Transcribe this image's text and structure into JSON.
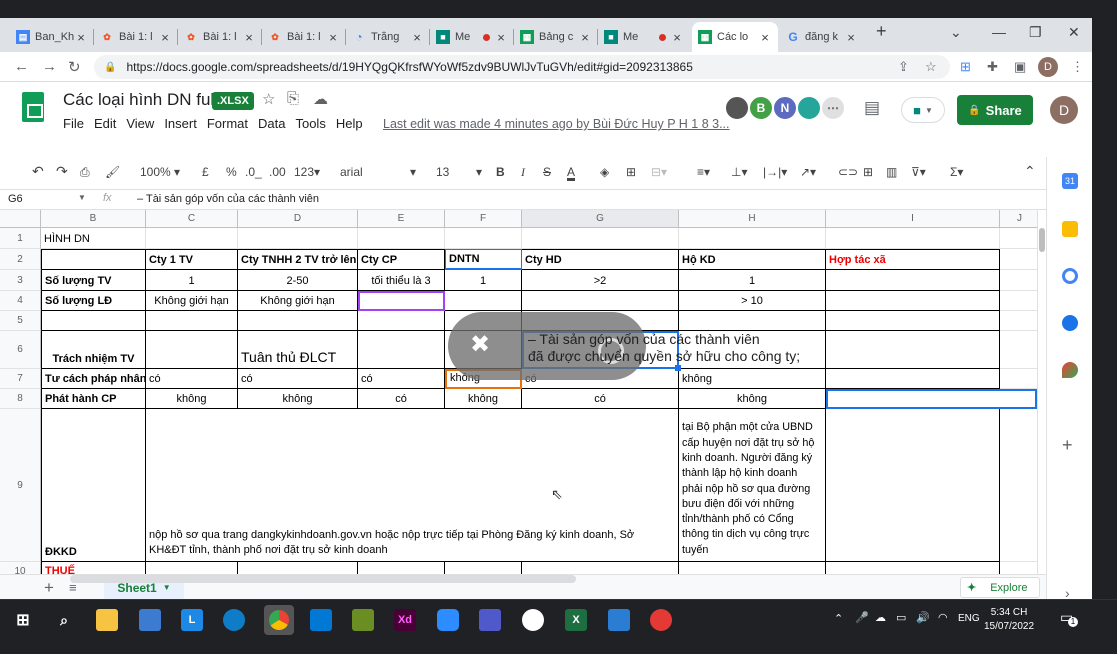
{
  "browser": {
    "tabs": [
      {
        "title": "Ban_Kh",
        "icon": "doc-icon"
      },
      {
        "title": "Bài 1: l",
        "icon": "web-icon"
      },
      {
        "title": "Bài 1: l",
        "icon": "web-icon"
      },
      {
        "title": "Bài 1: l",
        "icon": "web-icon"
      },
      {
        "title": "Trắng",
        "icon": "globe-icon"
      },
      {
        "title": "Me",
        "icon": "meet-icon"
      },
      {
        "title": "Bảng c",
        "icon": "sheets-icon"
      },
      {
        "title": "Me",
        "icon": "meet-icon"
      },
      {
        "title": "Các lo",
        "icon": "sheets-icon"
      },
      {
        "title": "đăng k",
        "icon": "google-icon"
      }
    ],
    "url": "https://docs.google.com/spreadsheets/d/19HYQgQKfrsfWYoWf5zdv9BUWlJvTuGVh/edit#gid=2092313865",
    "profile": "D"
  },
  "doc": {
    "title": "Các loại hình DN full",
    "badge": ".XLSX",
    "menus": [
      "File",
      "Edit",
      "View",
      "Insert",
      "Format",
      "Data",
      "Tools",
      "Help"
    ],
    "last_edit": "Last edit was made 4 minutes ago by Bùi Đức Huy P H 1 8 3...",
    "share": "Share",
    "collaborators": [
      "B",
      "N"
    ],
    "user": "D"
  },
  "toolbar": {
    "zoom": "100%",
    "currency": "£",
    "percent": "%",
    "dec_less": ".0_",
    "dec_more": ".00",
    "format": "123",
    "font": "arial",
    "size": "13"
  },
  "formula": {
    "cell": "G6",
    "fx": "fx",
    "value": "– Tài sản góp vốn của các thành viên"
  },
  "columns": [
    "B",
    "C",
    "D",
    "E",
    "F",
    "G",
    "H",
    "I",
    "J"
  ],
  "rows": [
    "1",
    "2",
    "3",
    "4",
    "5",
    "6",
    "7",
    "8",
    "9",
    "10"
  ],
  "cells": {
    "r1": {
      "b": "HÌNH DN"
    },
    "r2": {
      "c": "Cty 1 TV",
      "d": "Cty TNHH 2 TV trở lên",
      "e": "Cty CP",
      "f": "DNTN",
      "g": "Cty HD",
      "h": "Hộ KD",
      "i": "Hợp tác xã"
    },
    "r3": {
      "b": "Số lượng TV",
      "c": "1",
      "d": "2-50",
      "e": "tối thiểu là 3",
      "f": "1",
      "g": ">2",
      "h": "1"
    },
    "r4": {
      "b": "Số lượng LĐ",
      "c": "Không giới hạn",
      "d": "Không giới hạn",
      "h": "> 10"
    },
    "r6": {
      "b": "Trách nhiệm TV",
      "d": "Tuân thủ ĐLCT",
      "g1": "– Tài sản góp vốn của các thành viên",
      "g2": " đã được chuyển quyền sở hữu cho công ty;"
    },
    "r7": {
      "b": "Tư cách pháp nhân",
      "c": "có",
      "d": "có",
      "e": "có",
      "f": "không",
      "g": "có",
      "h": "không"
    },
    "r8": {
      "b": "Phát hành CP",
      "c": "không",
      "d": "không",
      "e": "có",
      "f": "không",
      "g": "có",
      "h": "không"
    },
    "r9": {
      "b": "ĐKKD",
      "c1": "nộp hồ sơ qua trang dangkykinhdoanh.gov.vn hoặc nộp trực tiếp tại Phòng Đăng ký kinh doanh, Sở",
      "c2": "KH&ĐT tỉnh, thành phố nơi đặt trụ sở kinh doanh",
      "h": [
        "tại Bộ phận một cửa UBND",
        "cấp huyện nơi đặt trụ sở hộ",
        "kinh doanh. Người đăng ký",
        "thành lập hộ kinh doanh",
        "phải nộp hồ sơ qua đường",
        "bưu điện đối với những",
        "tỉnh/thành phố có Cổng",
        "thông tin dịch vụ công trực",
        "tuyến"
      ]
    },
    "r10": {
      "b": "THUẾ"
    }
  },
  "sheet_tab": "Sheet1",
  "explore": "Explore",
  "taskbar": {
    "lang": "ENG",
    "time": "5:34 CH",
    "date": "15/07/2022",
    "notif": "1"
  }
}
